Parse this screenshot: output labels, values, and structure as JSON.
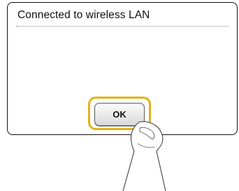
{
  "dialog": {
    "message": "Connected to wireless LAN",
    "ok_label": "OK"
  },
  "colors": {
    "frame_border": "#111111",
    "highlight": "#e2b217",
    "button_top": "#fdfdfd",
    "button_bottom": "#d8d8d8"
  },
  "icons": {
    "pointer": "finger-icon"
  }
}
